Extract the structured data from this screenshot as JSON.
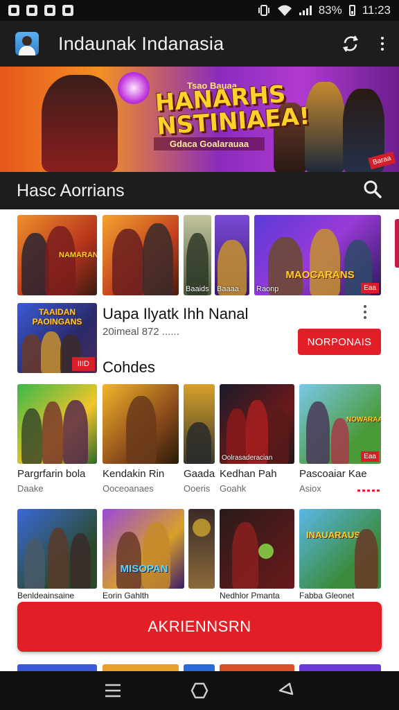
{
  "status_bar": {
    "time": "11:23",
    "battery": "83%",
    "icons": [
      "notification-icon",
      "notification-icon",
      "notification-icon",
      "gamepad-icon",
      "vibrate-icon",
      "wifi-icon",
      "signal-icon",
      "battery-icon"
    ]
  },
  "app_bar": {
    "title": "Indaunak Indanasia",
    "icons": [
      "avatar",
      "sync-icon",
      "more-vert-icon"
    ]
  },
  "hero": {
    "top_line": "Tsao Bauaa",
    "title": "HANARHS NSTINIAEA!",
    "subline": "Gdaca Goalarauaa",
    "tag": "Baraa"
  },
  "section": {
    "title": "Hasc Aorrians"
  },
  "top_row": [
    {
      "label": "",
      "logo": "NAMARANS"
    },
    {
      "label": "",
      "logo": ""
    },
    {
      "label": "Baaids",
      "logo": ""
    },
    {
      "label": "Baaaa",
      "logo": ""
    },
    {
      "label": "Raonp",
      "logo": "MAOCARANS",
      "badge": "Eaa"
    }
  ],
  "feature": {
    "logo": "TAAIDAN PAOINGANS",
    "badge": "IIID",
    "title": "Uapa Ilyatk Ihh Nanal",
    "meta": "20imeal 872 ......",
    "button": "NORPONAIS",
    "section_label": "Cohdes"
  },
  "grid_row_1": [
    {
      "title": "Pargrfarin bola",
      "sub": "Daake"
    },
    {
      "title": "Kendakin Rin",
      "sub": "Ooceoanaes"
    },
    {
      "title": "Gaada",
      "sub": "Ooeris"
    },
    {
      "title": "Kedhan Pah",
      "sub": "Goahk",
      "tile_label": "Oolrasaderacian",
      "tile_badge": ""
    },
    {
      "title": "Pascoaiar Kae",
      "sub": "Asiox",
      "tile_badge": "Eaa",
      "logo": "NOWARAANS"
    }
  ],
  "grid_row_2": [
    {
      "title": "Benldeainsaine"
    },
    {
      "title": "Eorin Gahlth",
      "logo": "MISOPAN"
    },
    {
      "title": ""
    },
    {
      "title": "Nedhlor Pmanta"
    },
    {
      "title": "Fabba Gleonet",
      "logo": "INAUARAUS"
    }
  ],
  "cta": {
    "label": "AKRIENNSRN"
  },
  "nav_bar": {
    "icons": [
      "recents-icon",
      "home-icon",
      "back-icon"
    ]
  },
  "colors": {
    "accent": "#e21f26",
    "appbar": "#1d1d1d",
    "statusbar": "#0d0d0d"
  }
}
